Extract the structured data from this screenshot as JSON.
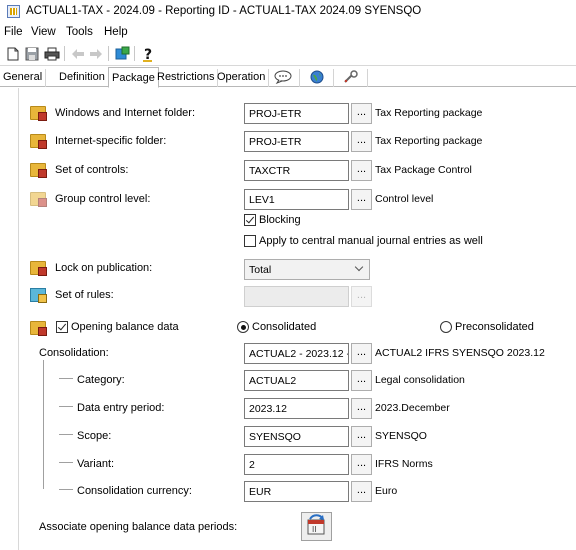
{
  "window": {
    "title": "ACTUAL1-TAX - 2024.09 - Reporting ID - ACTUAL1-TAX  2024.09 SYENSQO"
  },
  "menu": [
    "File",
    "View",
    "Tools",
    "Help"
  ],
  "toolbar": {
    "icons": [
      "new-document-icon",
      "save-icon",
      "print-icon",
      "back-icon",
      "forward-icon",
      "launch-icon",
      "help-icon"
    ]
  },
  "tabs": [
    {
      "label": "General"
    },
    {
      "label": "Definition"
    },
    {
      "label": "Package",
      "active": true
    },
    {
      "label": "Restrictions"
    },
    {
      "label": "Operation"
    }
  ],
  "form": {
    "windows_folder": {
      "label": "Windows and Internet folder:",
      "value": "PROJ-ETR",
      "desc": "Tax Reporting package"
    },
    "internet_folder": {
      "label": "Internet-specific folder:",
      "value": "PROJ-ETR",
      "desc": "Tax Reporting package"
    },
    "set_of_controls": {
      "label": "Set of controls:",
      "value": "TAXCTR",
      "desc": "Tax Package Control"
    },
    "group_control_level": {
      "label": "Group control level:",
      "value": "LEV1",
      "desc": "Control level"
    },
    "blocking": {
      "label": "Blocking",
      "checked": true
    },
    "apply_journal": {
      "label": "Apply to central manual journal entries as well",
      "checked": false
    },
    "lock_on_publication": {
      "label": "Lock on publication:",
      "value": "Total"
    },
    "set_of_rules": {
      "label": "Set of rules:",
      "value": ""
    },
    "opening_balance": {
      "label": "Opening balance data",
      "checked": true
    },
    "radio_consolidated": {
      "label": "Consolidated",
      "selected": true
    },
    "radio_preconsolidated": {
      "label": "Preconsolidated",
      "selected": false
    },
    "consolidation": {
      "label": "Consolidation:",
      "value": "ACTUAL2 - 2023.12 - S",
      "desc": "ACTUAL2 IFRS SYENSQO 2023.12"
    },
    "category": {
      "label": "Category:",
      "value": "ACTUAL2",
      "desc": "Legal consolidation"
    },
    "data_entry_period": {
      "label": "Data entry period:",
      "value": "2023.12",
      "desc": "2023.December"
    },
    "scope": {
      "label": "Scope:",
      "value": "SYENSQO",
      "desc": "SYENSQO"
    },
    "variant": {
      "label": "Variant:",
      "value": "2",
      "desc": "IFRS Norms"
    },
    "consolidation_currency": {
      "label": "Consolidation currency:",
      "value": "EUR",
      "desc": "Euro"
    },
    "associate_periods": {
      "label": "Associate opening balance data periods:"
    },
    "browse_label": "..."
  }
}
